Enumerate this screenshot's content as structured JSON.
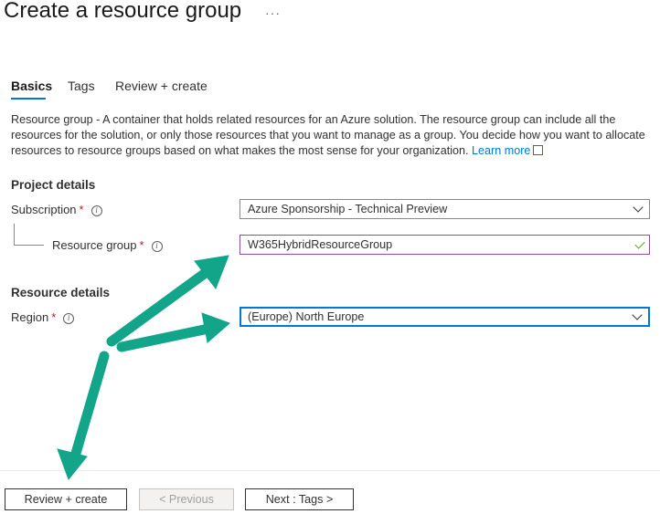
{
  "page": {
    "title": "Create a resource group",
    "more_label": "···"
  },
  "tabs": [
    {
      "label": "Basics",
      "active": true
    },
    {
      "label": "Tags",
      "active": false
    },
    {
      "label": "Review + create",
      "active": false
    }
  ],
  "description": {
    "text": "Resource group - A container that holds related resources for an Azure solution. The resource group can include all the resources for the solution, or only those resources that you want to manage as a group. You decide how you want to allocate resources to resource groups based on what makes the most sense for your organization.",
    "link_label": "Learn more"
  },
  "project_details": {
    "heading": "Project details",
    "subscription": {
      "label": "Subscription",
      "required_mark": "*",
      "value": "Azure Sponsorship - Technical Preview"
    },
    "resource_group": {
      "label": "Resource group",
      "required_mark": "*",
      "value": "W365HybridResourceGroup",
      "valid": true
    }
  },
  "resource_details": {
    "heading": "Resource details",
    "region": {
      "label": "Region",
      "required_mark": "*",
      "value": "(Europe) North Europe"
    }
  },
  "footer": {
    "review_create_label": "Review + create",
    "previous_label": "< Previous",
    "next_label": "Next : Tags >"
  },
  "annotation_colors": {
    "arrow": "#12a58a"
  },
  "icons": {
    "info": "info-icon",
    "chevron": "chevron-down-icon",
    "check": "check-icon",
    "external_link": "external-link-icon",
    "more": "ellipsis-icon"
  }
}
